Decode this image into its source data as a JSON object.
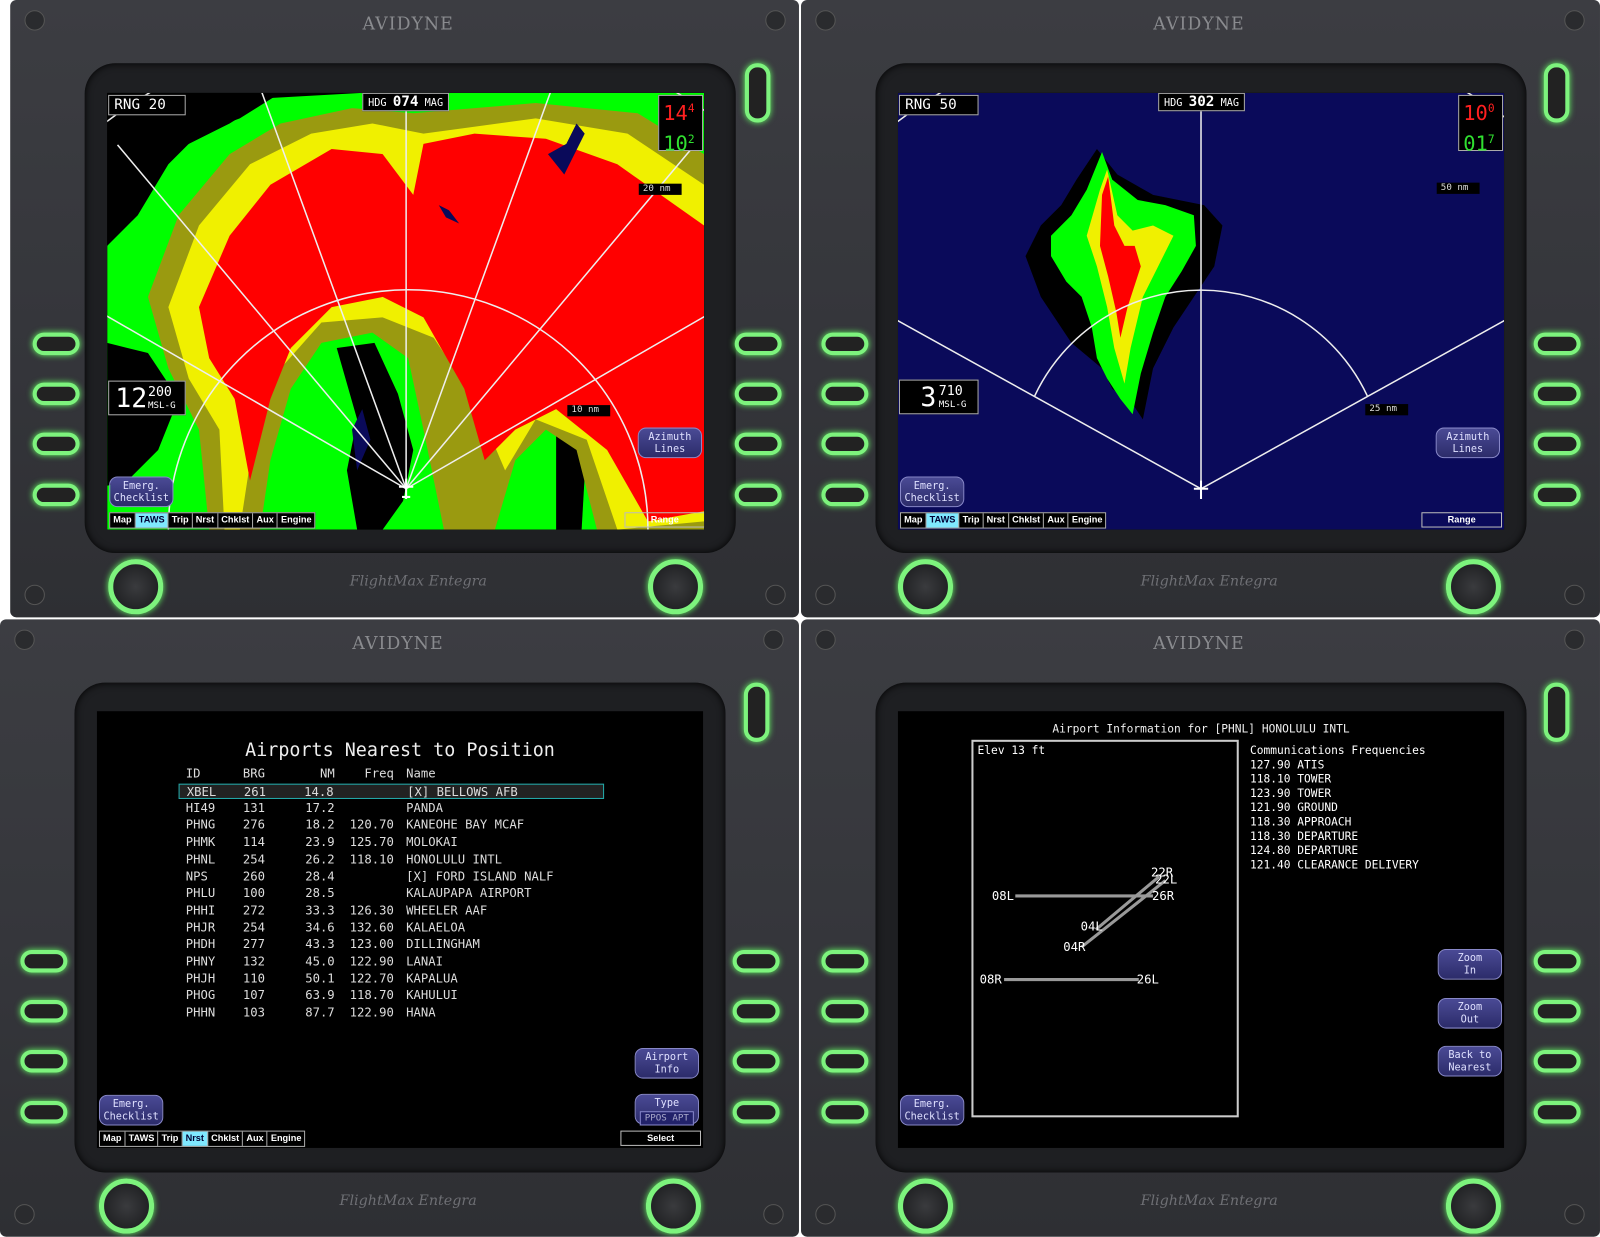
{
  "bezel": {
    "logo": "AVIDYNE",
    "brand": "FlightMax Entegra"
  },
  "tabs": [
    "Map",
    "TAWS",
    "Trip",
    "Nrst",
    "Chklst",
    "Aux",
    "Engine"
  ],
  "colors": {
    "active_tab": "#7fe8ff",
    "led": "#7df37d",
    "terrain_red": "#ff0000",
    "terrain_yellow": "#f0f000",
    "terrain_olive": "#9a9a10",
    "terrain_green": "#00ff00",
    "sky": "#0a0a5a"
  },
  "taws_20": {
    "range": "RNG 20",
    "hdg_label": "HDG",
    "hdg": "074",
    "mag": "MAG",
    "warn_top": "14",
    "warn_top_sup": "4",
    "warn_bot": "10",
    "warn_bot_sup": "2",
    "alt": "12",
    "alt_sup": "200",
    "alt_ref": "MSL-G",
    "ring_outer": "20 nm",
    "ring_inner": "10 nm",
    "azimuth_btn": [
      "Azimuth",
      "Lines"
    ],
    "emerg_btn": [
      "Emerg.",
      "Checklist"
    ],
    "active_tab": "TAWS",
    "right_btn": "Range"
  },
  "taws_50": {
    "range": "RNG 50",
    "hdg_label": "HDG",
    "hdg": "302",
    "mag": "MAG",
    "warn_top": "10",
    "warn_top_sup": "0",
    "warn_bot": "01",
    "warn_bot_sup": "7",
    "alt": "3",
    "alt_sup": "710",
    "alt_ref": "MSL-G",
    "ring_outer": "50 nm",
    "ring_inner": "25 nm",
    "azimuth_btn": [
      "Azimuth",
      "Lines"
    ],
    "emerg_btn": [
      "Emerg.",
      "Checklist"
    ],
    "active_tab": "TAWS",
    "right_btn": "Range"
  },
  "nearest": {
    "title": "Airports Nearest to Position",
    "headers": [
      "ID",
      "BRG",
      "NM",
      "Freq",
      "Name"
    ],
    "rows": [
      [
        "XBEL",
        "261",
        "14.8",
        "",
        "[X] BELLOWS AFB"
      ],
      [
        "HI49",
        "131",
        "17.2",
        "",
        "PANDA"
      ],
      [
        "PHNG",
        "276",
        "18.2",
        "120.70",
        "KANEOHE BAY MCAF"
      ],
      [
        "PHMK",
        "114",
        "23.9",
        "125.70",
        "MOLOKAI"
      ],
      [
        "PHNL",
        "254",
        "26.2",
        "118.10",
        "HONOLULU INTL"
      ],
      [
        "NPS",
        "260",
        "28.4",
        "",
        "[X] FORD ISLAND NALF"
      ],
      [
        "PHLU",
        "100",
        "28.5",
        "",
        "KALAUPAPA AIRPORT"
      ],
      [
        "PHHI",
        "272",
        "33.3",
        "126.30",
        "WHEELER AAF"
      ],
      [
        "PHJR",
        "254",
        "34.6",
        "132.60",
        "KALAELOA"
      ],
      [
        "PHDH",
        "277",
        "43.3",
        "123.00",
        "DILLINGHAM"
      ],
      [
        "PHNY",
        "132",
        "45.0",
        "122.90",
        "LANAI"
      ],
      [
        "PHJH",
        "110",
        "50.1",
        "122.70",
        "KAPALUA"
      ],
      [
        "PHOG",
        "107",
        "63.9",
        "118.70",
        "KAHULUI"
      ],
      [
        "PHHN",
        "103",
        "87.7",
        "122.90",
        "HANA"
      ]
    ],
    "airport_info_btn": [
      "Airport",
      "Info"
    ],
    "type_btn": "Type",
    "type_value": "PPOS APT",
    "emerg_btn": [
      "Emerg.",
      "Checklist"
    ],
    "active_tab": "Nrst",
    "right_btn": "Select"
  },
  "airport_info": {
    "title": "Airport Information for [PHNL] HONOLULU INTL",
    "elev": "Elev 13 ft",
    "freq_heading": "Communications Frequencies",
    "freqs": [
      "127.90 ATIS",
      "118.10 TOWER",
      "123.90 TOWER",
      "121.90 GROUND",
      "118.30 APPROACH",
      "118.30 DEPARTURE",
      "124.80 DEPARTURE",
      "121.40 CLEARANCE DELIVERY"
    ],
    "runways": {
      "r08L": "08L",
      "r26R": "26R",
      "r08R": "08R",
      "r26L": "26L",
      "r04L": "04L",
      "r04R": "04R",
      "r22L": "22L",
      "r22R": "22R"
    },
    "zoom_in_btn": [
      "Zoom",
      "In"
    ],
    "zoom_out_btn": [
      "Zoom",
      "Out"
    ],
    "back_btn": [
      "Back to",
      "Nearest"
    ],
    "emerg_btn": [
      "Emerg.",
      "Checklist"
    ]
  }
}
